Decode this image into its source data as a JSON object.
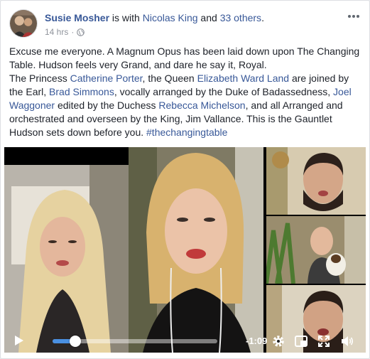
{
  "post": {
    "author": "Susie Mosher",
    "with_text": " is with ",
    "tagged": "Nicolas King",
    "and_text": " and ",
    "others": "33 others",
    "period": ".",
    "time": "14 hrs",
    "separator": "·"
  },
  "body": {
    "line1": "Excuse me everyone. A Magnum Opus has been laid down upon The Changing Table. Hudson feels very Grand, and dare he say it, Royal.",
    "t1": "The Princess ",
    "link_catherine": "Catherine Porter",
    "t2": ", the Queen ",
    "link_elizabeth": "Elizabeth Ward Land",
    "t3": " are joined by the Earl, ",
    "link_brad": "Brad Simmons",
    "t4": ", vocally arranged by the Duke of Badassedness, ",
    "link_joel": "Joel Waggoner",
    "t5": " edited by the Duchess ",
    "link_rebecca": "Rebecca Michelson",
    "t6": ", and all Arranged and orchestrated and overseen by the King, Jim Vallance. This is the Gauntlet Hudson sets down before you. ",
    "hashtag": "#thechangingtable"
  },
  "video": {
    "time_remaining": "-1:09",
    "progress": 0.14
  },
  "icons": {
    "more": "more-options-icon",
    "globe": "globe-icon",
    "play": "play-icon",
    "settings": "gear-icon",
    "pip": "picture-in-picture-icon",
    "fullscreen": "fullscreen-icon",
    "volume": "volume-icon"
  },
  "colors": {
    "link": "#385898",
    "scrub": "#4a90e2"
  }
}
